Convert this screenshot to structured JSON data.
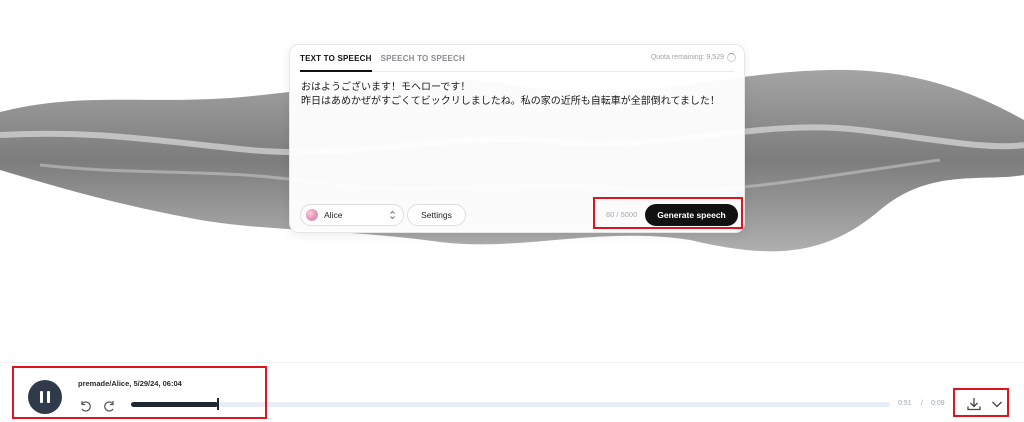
{
  "tabs": [
    {
      "label": "TEXT TO SPEECH",
      "active": true
    },
    {
      "label": "SPEECH TO SPEECH",
      "active": false
    }
  ],
  "quota_text": "Quota remaining: 9,529",
  "input_text": "おはようございます！モヘローです！\n昨日はあめかぜがすごくてビックリしましたね。私の家の近所も自転車が全部倒れてました！",
  "voice": {
    "name": "Alice",
    "icon": "voice-avatar"
  },
  "settings_label": "Settings",
  "char_count": "60 / 5000",
  "generate_label": "Generate speech",
  "player": {
    "title": "premade/Alice, 5/29/24, 06:04",
    "state": "playing",
    "current_time": "0:51",
    "separator": "/",
    "total_time": "0:09",
    "progress_fraction": 0.115,
    "icons": [
      "pause-icon",
      "rewind-10-icon",
      "forward-10-icon",
      "download-icon",
      "chevron-down-icon"
    ]
  },
  "colors": {
    "primary_button": "#111111",
    "play_button": "#2f3a4b",
    "highlight": "#e0141e",
    "progress_fill": "#1f2733",
    "progress_track": "#e7eef7"
  }
}
